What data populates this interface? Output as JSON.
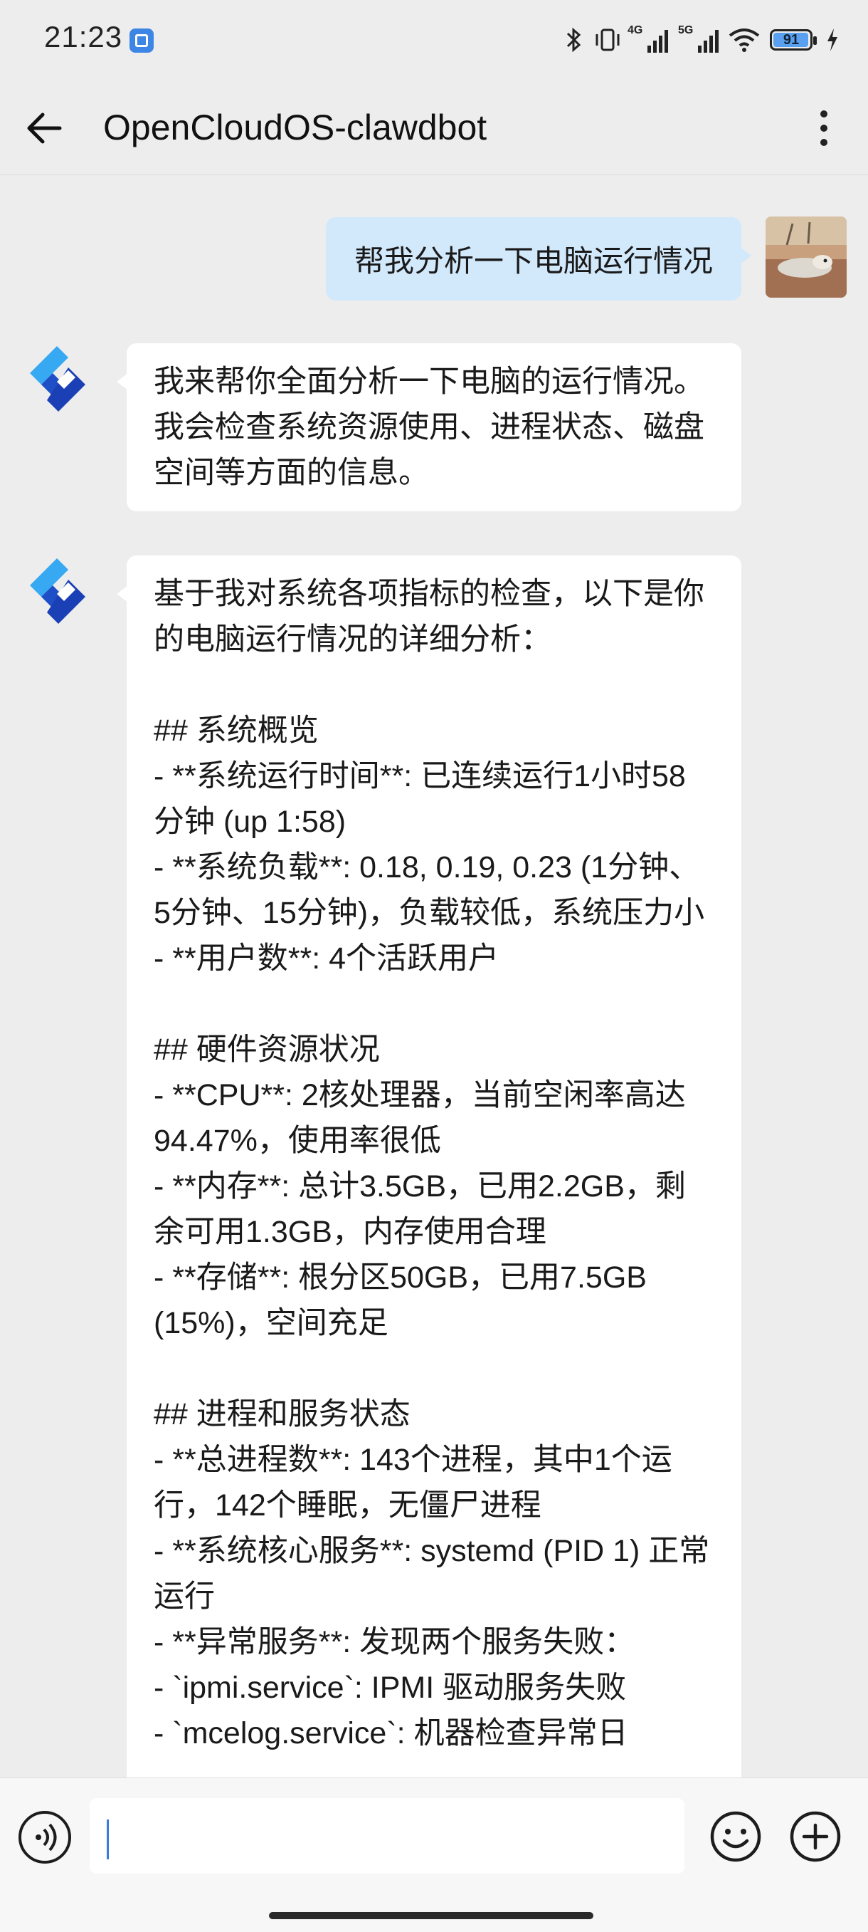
{
  "status_bar": {
    "time": "21:23",
    "network_a": "4G",
    "network_b": "5G",
    "battery": "91",
    "icons": [
      "bluetooth-icon",
      "vibrate-icon",
      "signal-icon",
      "wifi-icon",
      "battery-icon",
      "charging-icon"
    ]
  },
  "header": {
    "title": "OpenCloudOS-clawdbot",
    "back_icon": "arrow-left-icon",
    "menu_icon": "more-vertical-icon"
  },
  "messages": [
    {
      "role": "user",
      "text": "帮我分析一下电脑运行情况"
    },
    {
      "role": "bot",
      "text": "我来帮你全面分析一下电脑的运行情况。我会检查系统资源使用、进程状态、磁盘空间等方面的信息。"
    },
    {
      "role": "bot",
      "text": "基于我对系统各项指标的检查，以下是你的电脑运行情况的详细分析：\n\n## 系统概览\n- **系统运行时间**: 已连续运行1小时58分钟 (up 1:58)\n- **系统负载**: 0.18, 0.19, 0.23 (1分钟、5分钟、15分钟)，负载较低，系统压力小\n- **用户数**: 4个活跃用户\n\n## 硬件资源状况\n- **CPU**: 2核处理器，当前空闲率高达94.47%，使用率很低\n- **内存**: 总计3.5GB，已用2.2GB，剩余可用1.3GB，内存使用合理\n- **存储**: 根分区50GB，已用7.5GB (15%)，空间充足\n\n## 进程和服务状态\n- **总进程数**: 143个进程，其中1个运行，142个睡眠，无僵尸进程\n- **系统核心服务**: systemd (PID 1) 正常运行\n- **异常服务**: 发现两个服务失败：\n- `ipmi.service`: IPMI 驱动服务失败\n- `mcelog.service`: 机器检查异常日"
    }
  ],
  "input": {
    "placeholder": "",
    "value": ""
  },
  "colors": {
    "background": "#ededed",
    "user_bubble": "#d2e8fb",
    "bot_bubble": "#ffffff",
    "accent": "#3a7ce0"
  }
}
